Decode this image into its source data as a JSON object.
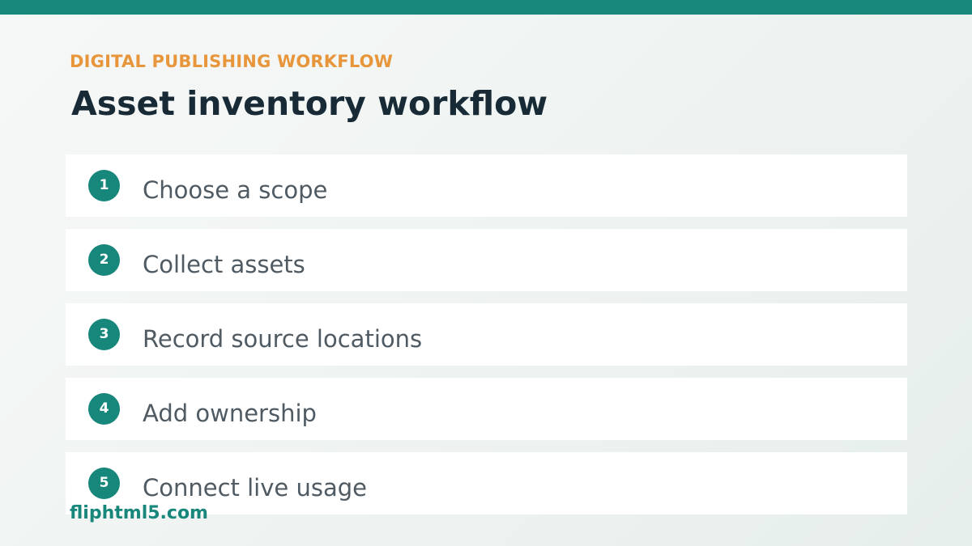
{
  "header": {
    "eyebrow": "DIGITAL PUBLISHING WORKFLOW",
    "title": "Asset inventory workflow"
  },
  "steps": [
    {
      "number": "1",
      "label": "Choose a scope"
    },
    {
      "number": "2",
      "label": "Collect assets"
    },
    {
      "number": "3",
      "label": "Record source locations"
    },
    {
      "number": "4",
      "label": "Add ownership"
    },
    {
      "number": "5",
      "label": "Connect live usage"
    }
  ],
  "watermark": "fliphtml5.com",
  "colors": {
    "accent": "#17877b",
    "eyebrow": "#e8963c",
    "title": "#172a36",
    "step_text": "#4f5a62",
    "card": "#ffffff"
  }
}
